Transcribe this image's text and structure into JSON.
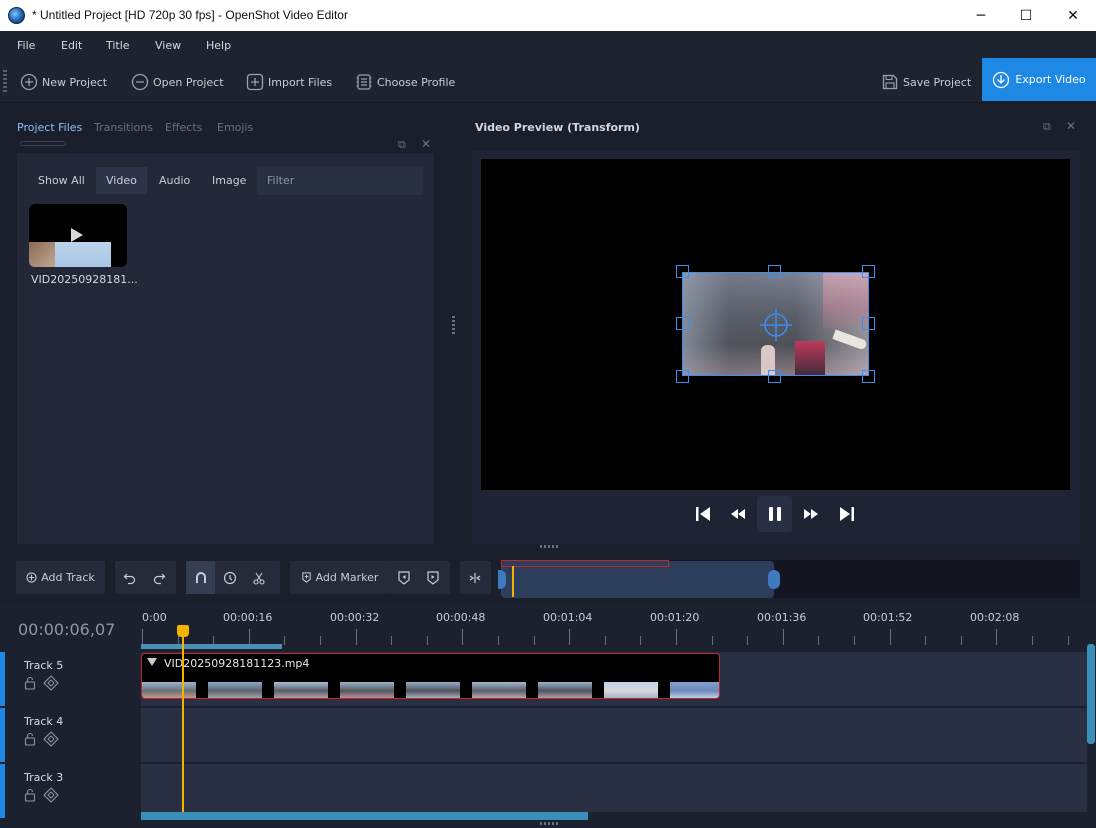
{
  "window": {
    "title": "* Untitled Project [HD 720p 30 fps] - OpenShot Video Editor",
    "controls": {
      "minimize": "─",
      "maximize": "☐",
      "close": "✕"
    }
  },
  "menu": [
    {
      "label": "File"
    },
    {
      "label": "Edit"
    },
    {
      "label": "Title"
    },
    {
      "label": "View"
    },
    {
      "label": "Help"
    }
  ],
  "toolbar": {
    "new_project": "New Project",
    "open_project": "Open Project",
    "import_files": "Import Files",
    "choose_profile": "Choose Profile",
    "save_project": "Save Project",
    "export_video": "Export Video"
  },
  "left_panel": {
    "tabs": [
      "Project Files",
      "Transitions",
      "Effects",
      "Emojis"
    ],
    "filter_tabs": [
      "Show All",
      "Video",
      "Audio",
      "Image"
    ],
    "filter_placeholder": "Filter",
    "file": {
      "label": "VID20250928181..."
    }
  },
  "preview": {
    "title": "Video Preview (Transform)"
  },
  "timeline_toolbar": {
    "add_track": "Add Track",
    "add_marker": "Add Marker"
  },
  "timeline": {
    "timecode": "00:00:06,07",
    "ruler": [
      "0:00",
      "00:00:16",
      "00:00:32",
      "00:00:48",
      "00:01:04",
      "00:01:20",
      "00:01:36",
      "00:01:52",
      "00:02:08"
    ],
    "tracks": [
      {
        "name": "Track 5"
      },
      {
        "name": "Track 4"
      },
      {
        "name": "Track 3"
      }
    ],
    "clip": {
      "name": "VID20250928181123.mp4"
    }
  },
  "colors": {
    "accent": "#1e88e5",
    "playhead": "#f5b300",
    "selection": "#c0262d",
    "panel_bg": "#222838"
  }
}
